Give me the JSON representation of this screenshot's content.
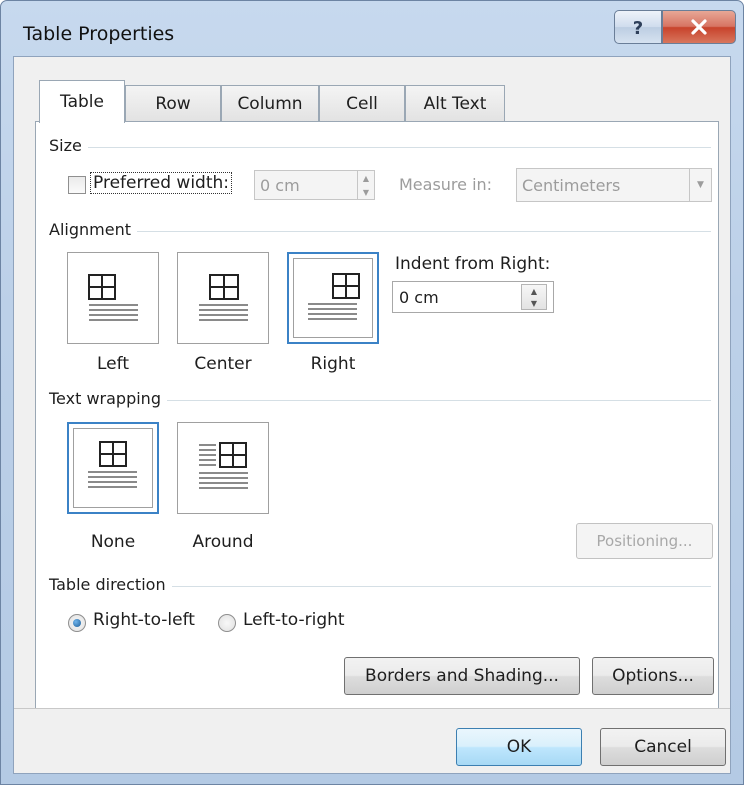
{
  "window": {
    "title": "Table Properties"
  },
  "icons": {
    "help": "help-icon",
    "close": "close-icon",
    "table_left": "table-align-left-icon",
    "table_center": "table-align-center-icon",
    "table_right": "table-align-right-icon",
    "wrap_none": "wrap-none-icon",
    "wrap_around": "wrap-around-icon"
  },
  "tabs": [
    {
      "label": "Table",
      "active": true
    },
    {
      "label": "Row"
    },
    {
      "label": "Column"
    },
    {
      "label": "Cell"
    },
    {
      "label": "Alt Text"
    }
  ],
  "size": {
    "group_label": "Size",
    "preferred_width_label": "Preferred width:",
    "preferred_width_checked": false,
    "width_value": "0 cm",
    "measure_in_label": "Measure in:",
    "measure_in_value": "Centimeters"
  },
  "alignment": {
    "group_label": "Alignment",
    "options": [
      "Left",
      "Center",
      "Right"
    ],
    "selected": "Right",
    "indent_label": "Indent from Right:",
    "indent_value": "0 cm"
  },
  "text_wrapping": {
    "group_label": "Text wrapping",
    "options": [
      "None",
      "Around"
    ],
    "selected": "None",
    "positioning_label": "Positioning..."
  },
  "table_direction": {
    "group_label": "Table direction",
    "options": [
      "Right-to-left",
      "Left-to-right"
    ],
    "selected": "Right-to-left"
  },
  "buttons": {
    "borders_shading": "Borders and Shading...",
    "options": "Options...",
    "ok": "OK",
    "cancel": "Cancel"
  },
  "colors": {
    "accent": "#3b82c6",
    "title_bar": "#bcd0e8",
    "close_button": "#c8432c"
  }
}
